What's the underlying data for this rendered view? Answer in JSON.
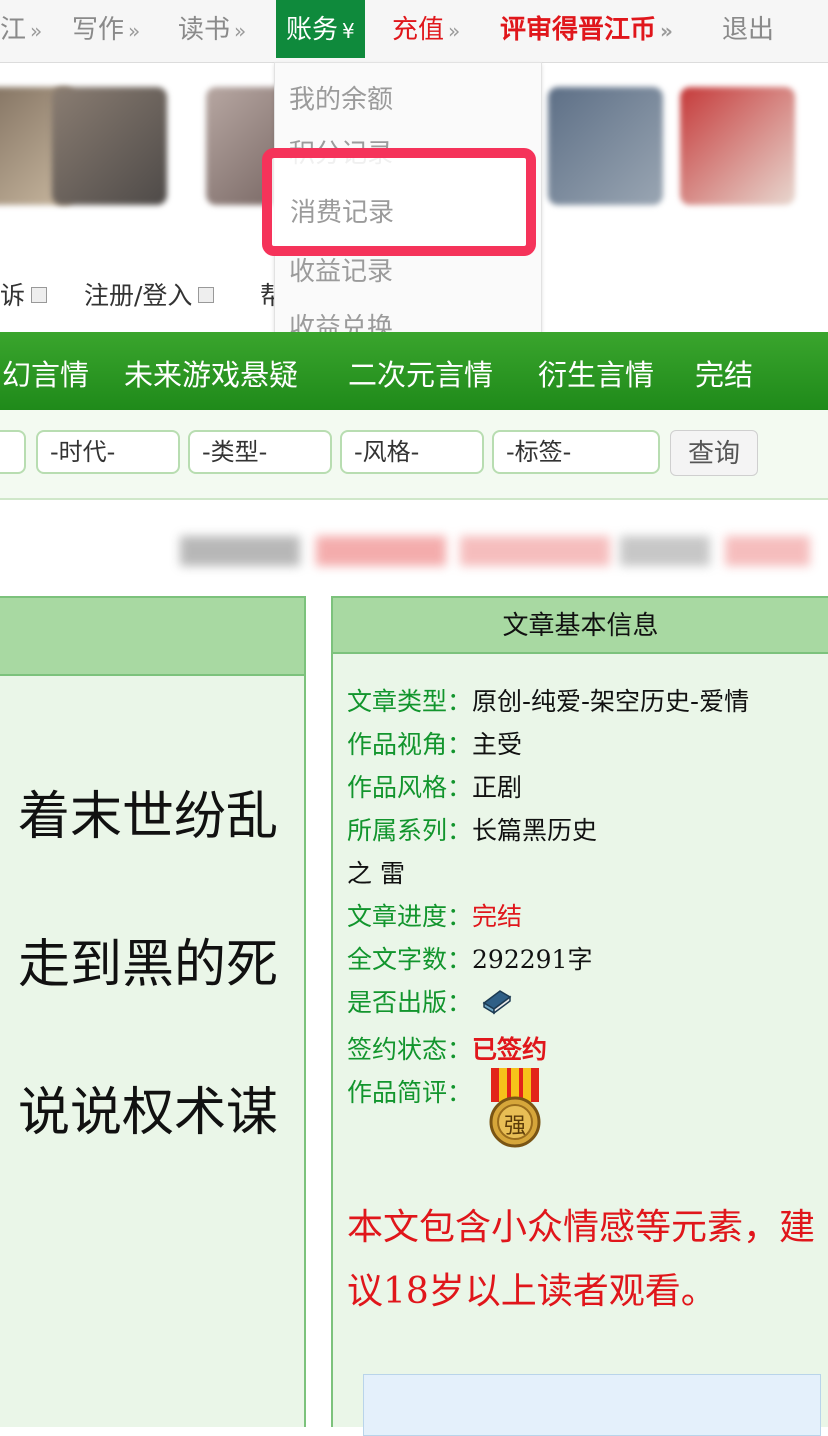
{
  "topnav": {
    "items": [
      {
        "label": "江",
        "arrow": "»"
      },
      {
        "label": "写作",
        "arrow": "»"
      },
      {
        "label": "读书",
        "arrow": "»"
      },
      {
        "label": "账务",
        "arrow": "¥"
      },
      {
        "label": "充值",
        "arrow": "»"
      },
      {
        "label": "评审得晋江币",
        "arrow": "»"
      },
      {
        "label": "退出"
      }
    ]
  },
  "dropdown": {
    "items": [
      "我的余额",
      "积分记录",
      "消费记录",
      "收益记录",
      "收益兑换"
    ]
  },
  "utilbar": {
    "items": [
      "诉",
      "注册/登入",
      "帮"
    ]
  },
  "categories": [
    "幻言情",
    "未来游戏悬疑",
    "二次元言情",
    "衍生言情",
    "完结"
  ],
  "filters": {
    "options": [
      "-时代-",
      "-类型-",
      "-风格-",
      "-标签-"
    ],
    "query_label": "查询"
  },
  "left_panel": {
    "lines": [
      "着末世纷乱",
      "走到黑的死",
      "说说权术谋"
    ]
  },
  "info": {
    "title": "文章基本信息",
    "rows": [
      {
        "label": "文章类型：",
        "value": "原创-纯爱-架空历史-爱情"
      },
      {
        "label": "作品视角：",
        "value": "主受"
      },
      {
        "label": "作品风格：",
        "value": "正剧"
      },
      {
        "label": "所属系列：",
        "value": "长篇黑历史"
      },
      {
        "label": "",
        "value": "之 雷"
      },
      {
        "label": "文章进度：",
        "value": "完结"
      },
      {
        "label": "全文字数：",
        "value": "292291字"
      },
      {
        "label": "是否出版：",
        "value": ""
      },
      {
        "label": "签约状态：",
        "value": "已签约"
      },
      {
        "label": "作品简评：",
        "value": ""
      }
    ],
    "medal_char": "强",
    "warning": "本文包含小众情感等元素，建议18岁以上读者观看。"
  },
  "colors": {
    "nav_active": "#0f8a3c",
    "category_bar": "#2a9a24",
    "label_green": "#12952d",
    "accent_red": "#e0161b",
    "highlight": "#f5335a"
  },
  "icons": [
    "book-icon",
    "medal-icon"
  ]
}
